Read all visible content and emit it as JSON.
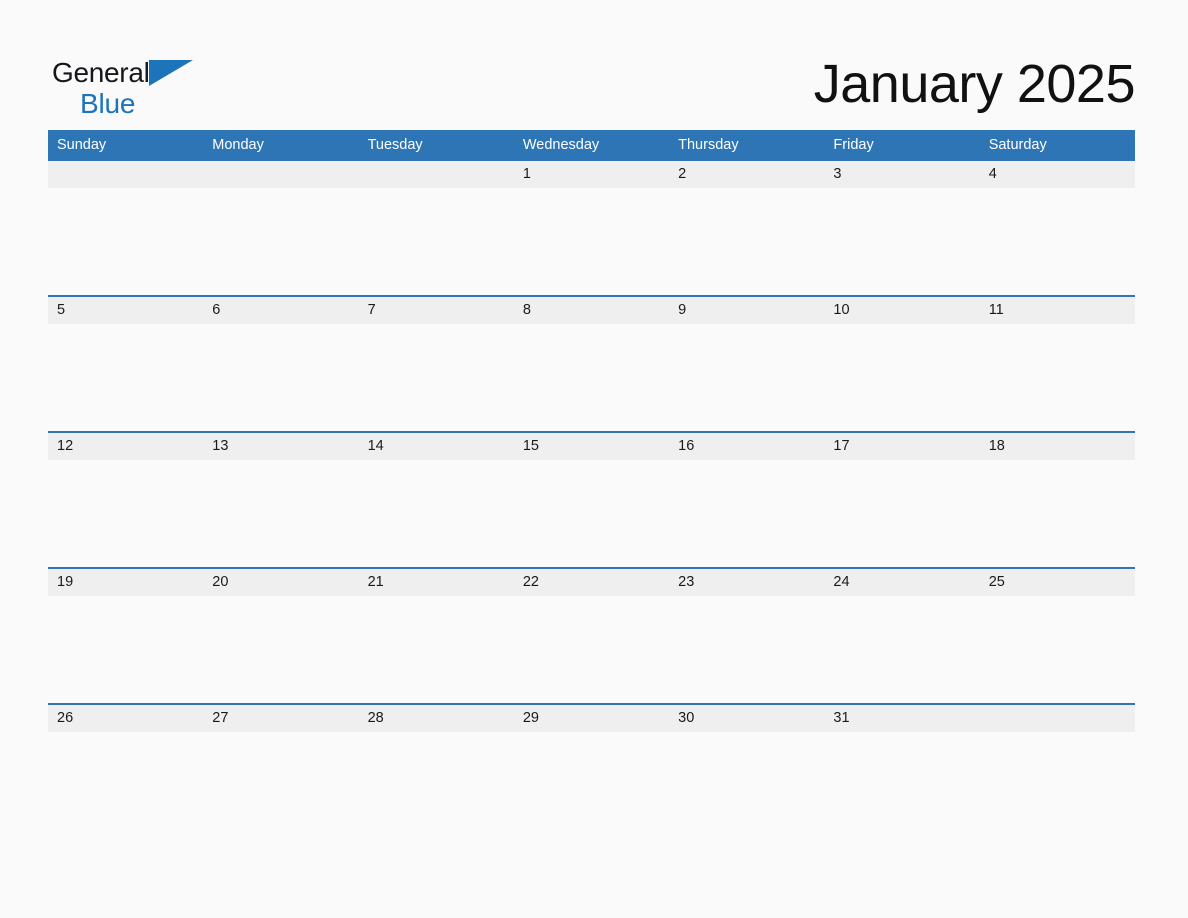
{
  "brand": {
    "name_top": "General",
    "name_bottom": "Blue",
    "triangle_icon": "blue-triangle-icon",
    "accent_color": "#1d74bb"
  },
  "header": {
    "title": "January 2025",
    "month": "January",
    "year": "2025"
  },
  "colors": {
    "header_blue": "#2e75b6",
    "date_strip_gray": "#efefef",
    "page_background": "#fafafa",
    "text_dark": "#1a1a1a",
    "header_text": "#ffffff"
  },
  "calendar": {
    "weekdays": [
      "Sunday",
      "Monday",
      "Tuesday",
      "Wednesday",
      "Thursday",
      "Friday",
      "Saturday"
    ],
    "weeks": [
      {
        "days": [
          "",
          "",
          "",
          "1",
          "2",
          "3",
          "4"
        ]
      },
      {
        "days": [
          "5",
          "6",
          "7",
          "8",
          "9",
          "10",
          "11"
        ]
      },
      {
        "days": [
          "12",
          "13",
          "14",
          "15",
          "16",
          "17",
          "18"
        ]
      },
      {
        "days": [
          "19",
          "20",
          "21",
          "22",
          "23",
          "24",
          "25"
        ]
      },
      {
        "days": [
          "26",
          "27",
          "28",
          "29",
          "30",
          "31",
          ""
        ]
      }
    ]
  }
}
